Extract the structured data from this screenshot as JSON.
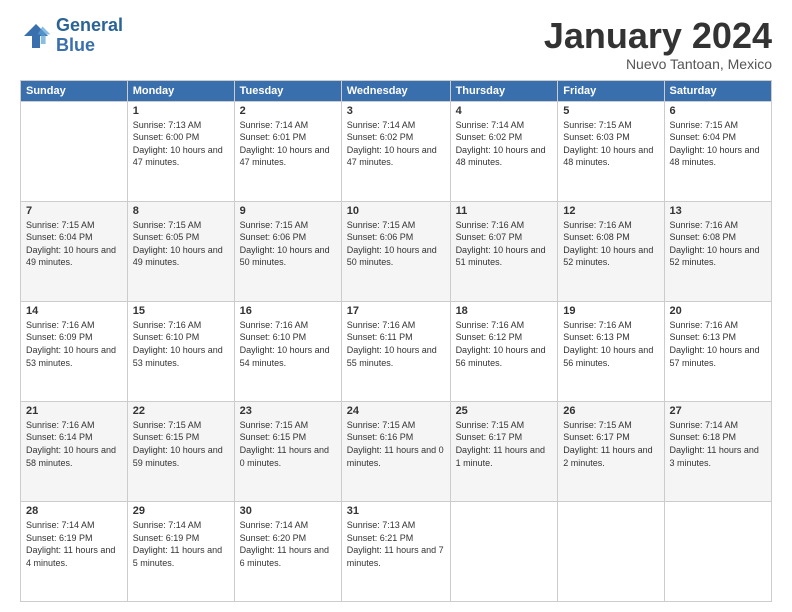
{
  "logo": {
    "line1": "General",
    "line2": "Blue"
  },
  "title": "January 2024",
  "subtitle": "Nuevo Tantoan, Mexico",
  "days_of_week": [
    "Sunday",
    "Monday",
    "Tuesday",
    "Wednesday",
    "Thursday",
    "Friday",
    "Saturday"
  ],
  "weeks": [
    [
      {
        "day": "",
        "sunrise": "",
        "sunset": "",
        "daylight": ""
      },
      {
        "day": "1",
        "sunrise": "Sunrise: 7:13 AM",
        "sunset": "Sunset: 6:00 PM",
        "daylight": "Daylight: 10 hours and 47 minutes."
      },
      {
        "day": "2",
        "sunrise": "Sunrise: 7:14 AM",
        "sunset": "Sunset: 6:01 PM",
        "daylight": "Daylight: 10 hours and 47 minutes."
      },
      {
        "day": "3",
        "sunrise": "Sunrise: 7:14 AM",
        "sunset": "Sunset: 6:02 PM",
        "daylight": "Daylight: 10 hours and 47 minutes."
      },
      {
        "day": "4",
        "sunrise": "Sunrise: 7:14 AM",
        "sunset": "Sunset: 6:02 PM",
        "daylight": "Daylight: 10 hours and 48 minutes."
      },
      {
        "day": "5",
        "sunrise": "Sunrise: 7:15 AM",
        "sunset": "Sunset: 6:03 PM",
        "daylight": "Daylight: 10 hours and 48 minutes."
      },
      {
        "day": "6",
        "sunrise": "Sunrise: 7:15 AM",
        "sunset": "Sunset: 6:04 PM",
        "daylight": "Daylight: 10 hours and 48 minutes."
      }
    ],
    [
      {
        "day": "7",
        "sunrise": "Sunrise: 7:15 AM",
        "sunset": "Sunset: 6:04 PM",
        "daylight": "Daylight: 10 hours and 49 minutes."
      },
      {
        "day": "8",
        "sunrise": "Sunrise: 7:15 AM",
        "sunset": "Sunset: 6:05 PM",
        "daylight": "Daylight: 10 hours and 49 minutes."
      },
      {
        "day": "9",
        "sunrise": "Sunrise: 7:15 AM",
        "sunset": "Sunset: 6:06 PM",
        "daylight": "Daylight: 10 hours and 50 minutes."
      },
      {
        "day": "10",
        "sunrise": "Sunrise: 7:15 AM",
        "sunset": "Sunset: 6:06 PM",
        "daylight": "Daylight: 10 hours and 50 minutes."
      },
      {
        "day": "11",
        "sunrise": "Sunrise: 7:16 AM",
        "sunset": "Sunset: 6:07 PM",
        "daylight": "Daylight: 10 hours and 51 minutes."
      },
      {
        "day": "12",
        "sunrise": "Sunrise: 7:16 AM",
        "sunset": "Sunset: 6:08 PM",
        "daylight": "Daylight: 10 hours and 52 minutes."
      },
      {
        "day": "13",
        "sunrise": "Sunrise: 7:16 AM",
        "sunset": "Sunset: 6:08 PM",
        "daylight": "Daylight: 10 hours and 52 minutes."
      }
    ],
    [
      {
        "day": "14",
        "sunrise": "Sunrise: 7:16 AM",
        "sunset": "Sunset: 6:09 PM",
        "daylight": "Daylight: 10 hours and 53 minutes."
      },
      {
        "day": "15",
        "sunrise": "Sunrise: 7:16 AM",
        "sunset": "Sunset: 6:10 PM",
        "daylight": "Daylight: 10 hours and 53 minutes."
      },
      {
        "day": "16",
        "sunrise": "Sunrise: 7:16 AM",
        "sunset": "Sunset: 6:10 PM",
        "daylight": "Daylight: 10 hours and 54 minutes."
      },
      {
        "day": "17",
        "sunrise": "Sunrise: 7:16 AM",
        "sunset": "Sunset: 6:11 PM",
        "daylight": "Daylight: 10 hours and 55 minutes."
      },
      {
        "day": "18",
        "sunrise": "Sunrise: 7:16 AM",
        "sunset": "Sunset: 6:12 PM",
        "daylight": "Daylight: 10 hours and 56 minutes."
      },
      {
        "day": "19",
        "sunrise": "Sunrise: 7:16 AM",
        "sunset": "Sunset: 6:13 PM",
        "daylight": "Daylight: 10 hours and 56 minutes."
      },
      {
        "day": "20",
        "sunrise": "Sunrise: 7:16 AM",
        "sunset": "Sunset: 6:13 PM",
        "daylight": "Daylight: 10 hours and 57 minutes."
      }
    ],
    [
      {
        "day": "21",
        "sunrise": "Sunrise: 7:16 AM",
        "sunset": "Sunset: 6:14 PM",
        "daylight": "Daylight: 10 hours and 58 minutes."
      },
      {
        "day": "22",
        "sunrise": "Sunrise: 7:15 AM",
        "sunset": "Sunset: 6:15 PM",
        "daylight": "Daylight: 10 hours and 59 minutes."
      },
      {
        "day": "23",
        "sunrise": "Sunrise: 7:15 AM",
        "sunset": "Sunset: 6:15 PM",
        "daylight": "Daylight: 11 hours and 0 minutes."
      },
      {
        "day": "24",
        "sunrise": "Sunrise: 7:15 AM",
        "sunset": "Sunset: 6:16 PM",
        "daylight": "Daylight: 11 hours and 0 minutes."
      },
      {
        "day": "25",
        "sunrise": "Sunrise: 7:15 AM",
        "sunset": "Sunset: 6:17 PM",
        "daylight": "Daylight: 11 hours and 1 minute."
      },
      {
        "day": "26",
        "sunrise": "Sunrise: 7:15 AM",
        "sunset": "Sunset: 6:17 PM",
        "daylight": "Daylight: 11 hours and 2 minutes."
      },
      {
        "day": "27",
        "sunrise": "Sunrise: 7:14 AM",
        "sunset": "Sunset: 6:18 PM",
        "daylight": "Daylight: 11 hours and 3 minutes."
      }
    ],
    [
      {
        "day": "28",
        "sunrise": "Sunrise: 7:14 AM",
        "sunset": "Sunset: 6:19 PM",
        "daylight": "Daylight: 11 hours and 4 minutes."
      },
      {
        "day": "29",
        "sunrise": "Sunrise: 7:14 AM",
        "sunset": "Sunset: 6:19 PM",
        "daylight": "Daylight: 11 hours and 5 minutes."
      },
      {
        "day": "30",
        "sunrise": "Sunrise: 7:14 AM",
        "sunset": "Sunset: 6:20 PM",
        "daylight": "Daylight: 11 hours and 6 minutes."
      },
      {
        "day": "31",
        "sunrise": "Sunrise: 7:13 AM",
        "sunset": "Sunset: 6:21 PM",
        "daylight": "Daylight: 11 hours and 7 minutes."
      },
      {
        "day": "",
        "sunrise": "",
        "sunset": "",
        "daylight": ""
      },
      {
        "day": "",
        "sunrise": "",
        "sunset": "",
        "daylight": ""
      },
      {
        "day": "",
        "sunrise": "",
        "sunset": "",
        "daylight": ""
      }
    ]
  ]
}
